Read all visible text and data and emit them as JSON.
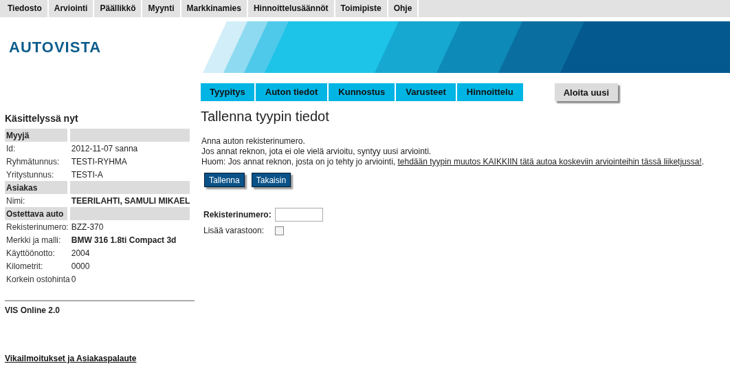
{
  "menu": [
    "Tiedosto",
    "Arviointi",
    "Päällikkö",
    "Myynti",
    "Markkinamies",
    "Hinnoittelusäännöt",
    "Toimipiste",
    "Ohje"
  ],
  "logo": "AUTOVISTA",
  "nav_tabs": [
    "Tyypitys",
    "Auton tiedot",
    "Kunnostus",
    "Varusteet",
    "Hinnoittelu"
  ],
  "start_button": "Aloita uusi",
  "sidebar": {
    "title": "Käsittelyssä nyt",
    "sections": [
      {
        "header": "Myyjä",
        "rows": [
          {
            "label": "Id:",
            "value": "2012-11-07  sanna",
            "emphasis": false
          },
          {
            "label": "Ryhmätunnus:",
            "value": "TESTI-RYHMA",
            "emphasis": false
          },
          {
            "label": "Yritystunnus:",
            "value": "TESTI-A",
            "emphasis": false
          }
        ]
      },
      {
        "header": "Asiakas",
        "rows": [
          {
            "label": "Nimi:",
            "value": "TEERILAHTI, SAMULI MIKAEL",
            "emphasis": true
          }
        ]
      },
      {
        "header": "Ostettava auto",
        "rows": [
          {
            "label": "Rekisterinumero:",
            "value": "BZZ-370",
            "emphasis": false
          },
          {
            "label": "Merkki ja malli:",
            "value": "BMW 316 1.8ti Compact 3d",
            "emphasis": true
          },
          {
            "label": "Käyttöönotto:",
            "value": "2004",
            "emphasis": false
          },
          {
            "label": "Kilometrit:",
            "value": "0000",
            "emphasis": false
          },
          {
            "label": "Korkein ostohinta",
            "value": "0",
            "emphasis": false
          }
        ]
      }
    ],
    "version": "VIS Online 2.0",
    "feedback_link": "Vikailmoitukset ja Asiakaspalaute"
  },
  "main": {
    "heading": "Tallenna tyypin tiedot",
    "lines": [
      "Anna auton rekisterinumero.",
      "Jos annat reknon, jota ei ole vielä arvioitu, syntyy uusi arviointi."
    ],
    "note": {
      "text": "Huom: Jos annat reknon, josta on jo tehty jo arviointi,",
      "link": "tehdään tyypin muutos KAIKKIIN tätä autoa koskeviin arviointeihin tässä liiketjussa!",
      "after": "."
    },
    "buttons": [
      "Tallenna",
      "Takaisin"
    ],
    "reg_field": {
      "label": "Rekisterinumero:"
    },
    "stock_checkbox": {
      "label": "Lisää varastoon:",
      "checked": false
    }
  }
}
